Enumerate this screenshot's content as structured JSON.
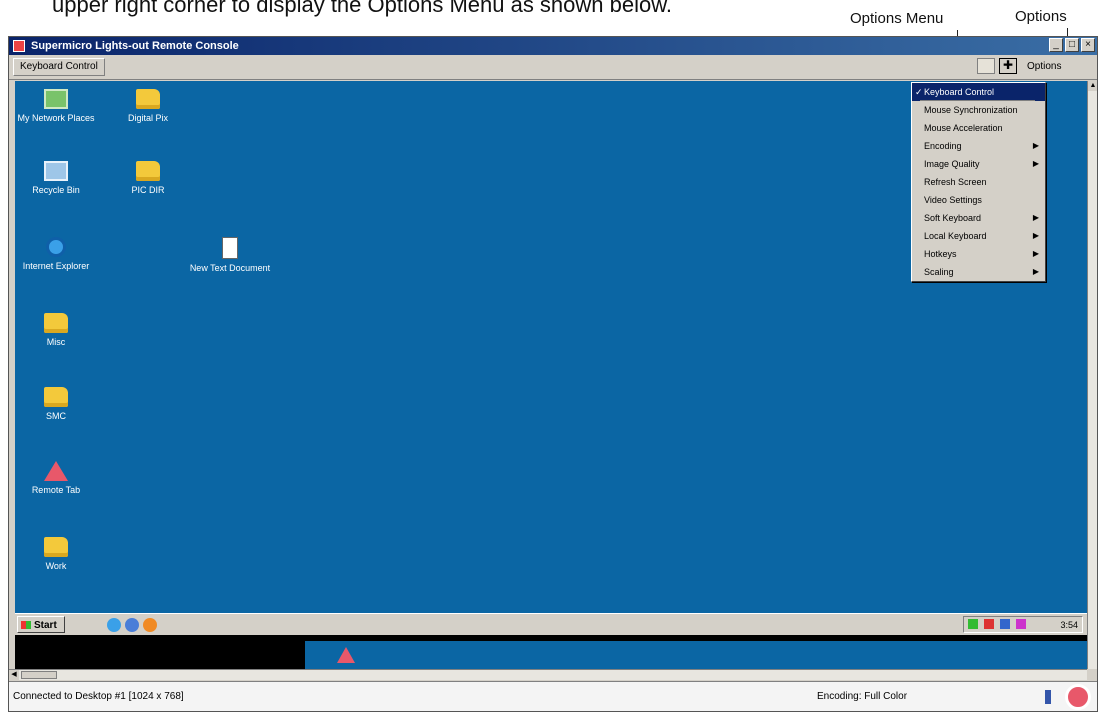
{
  "doc": {
    "caption": "upper right corner to display the Options Menu as shown below.",
    "callout_menu": "Options Menu",
    "callout_options": "Options"
  },
  "window": {
    "title": "Supermicro Lights-out Remote Console",
    "toolbar_button": "Keyboard Control",
    "toolbar_right_label": "Options"
  },
  "desktop": {
    "icons": [
      {
        "label": "My Network Places",
        "icon": "network-places-icon"
      },
      {
        "label": "Digital Pix",
        "icon": "folder-icon"
      },
      {
        "label": "Recycle Bin",
        "icon": "recycle-bin-icon"
      },
      {
        "label": "PIC DIR",
        "icon": "folder-icon"
      },
      {
        "label": "Internet Explorer",
        "icon": "internet-explorer-icon"
      },
      {
        "label": "New Text Document",
        "icon": "document-icon"
      },
      {
        "label": "Misc",
        "icon": "folder-icon"
      },
      {
        "label": "SMC",
        "icon": "folder-icon"
      },
      {
        "label": "Remote Tab",
        "icon": "shortcut-icon"
      },
      {
        "label": "Work",
        "icon": "folder-icon"
      }
    ]
  },
  "options_menu": {
    "items": [
      {
        "label": "Keyboard Control",
        "checked": true,
        "submenu": false
      },
      {
        "label": "Mouse Synchronization",
        "checked": false,
        "submenu": false
      },
      {
        "label": "Mouse Acceleration",
        "checked": false,
        "submenu": false
      },
      {
        "label": "Encoding",
        "checked": false,
        "submenu": true
      },
      {
        "label": "Image Quality",
        "checked": false,
        "submenu": true
      },
      {
        "label": "Refresh Screen",
        "checked": false,
        "submenu": false
      },
      {
        "label": "Video Settings",
        "checked": false,
        "submenu": false
      },
      {
        "label": "Soft Keyboard",
        "checked": false,
        "submenu": true
      },
      {
        "label": "Local Keyboard",
        "checked": false,
        "submenu": true
      },
      {
        "label": "Hotkeys",
        "checked": false,
        "submenu": true
      },
      {
        "label": "Scaling",
        "checked": false,
        "submenu": true
      }
    ]
  },
  "taskbar": {
    "start_label": "Start",
    "tray_time": "3:54"
  },
  "status": {
    "left": "Connected to Desktop #1 [1024 x 768]",
    "right": "Encoding: Full Color"
  }
}
